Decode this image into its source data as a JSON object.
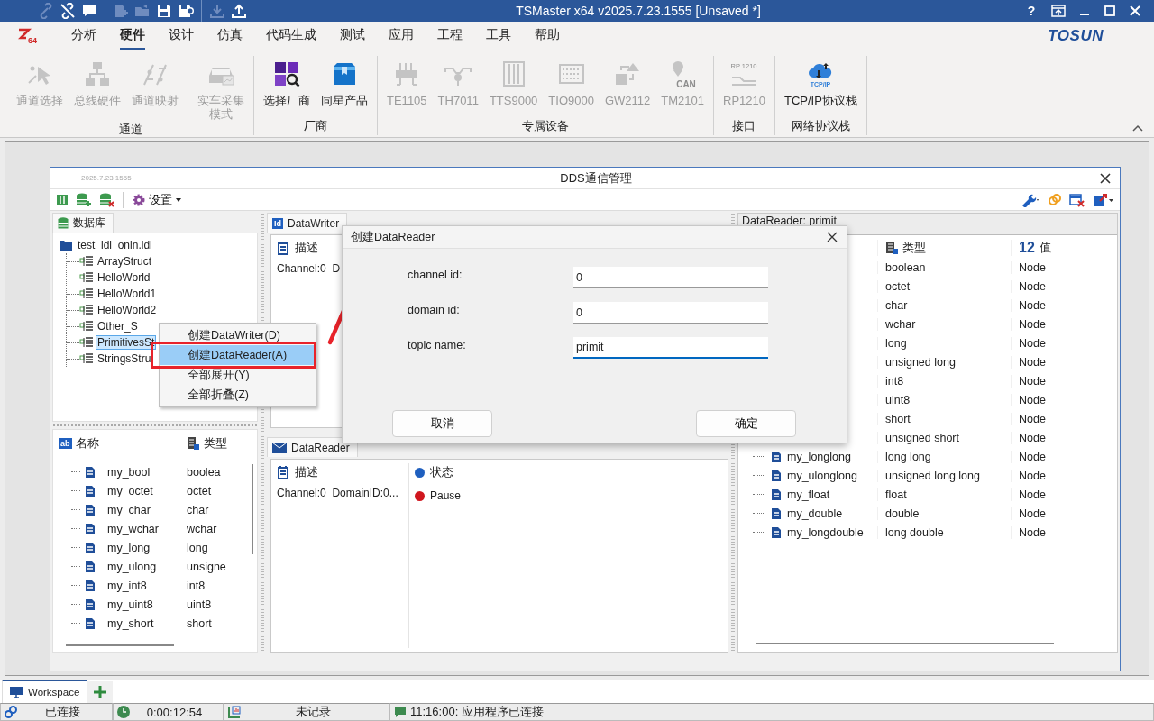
{
  "title_bar": {
    "title": "TSMaster x64 v2025.7.23.1555 [Unsaved *]",
    "help": "?",
    "quick_access": [
      {
        "buttons": [
          {
            "disabled": true
          },
          {
            "disabled": false
          },
          {
            "disabled": false
          }
        ]
      },
      {
        "buttons": [
          {
            "disabled": true
          },
          {
            "disabled": true
          },
          {
            "disabled": false
          },
          {
            "disabled": false
          }
        ]
      },
      {
        "buttons": [
          {
            "disabled": true
          },
          {
            "disabled": false
          }
        ]
      }
    ]
  },
  "menu": {
    "logo_text": "64",
    "brand": "TOSUN",
    "tabs": [
      {
        "label": "分析",
        "selected": false
      },
      {
        "label": "硬件",
        "selected": true
      },
      {
        "label": "设计",
        "selected": false
      },
      {
        "label": "仿真",
        "selected": false
      },
      {
        "label": "代码生成",
        "selected": false
      },
      {
        "label": "测试",
        "selected": false
      },
      {
        "label": "应用",
        "selected": false
      },
      {
        "label": "工程",
        "selected": false
      },
      {
        "label": "工具",
        "selected": false
      },
      {
        "label": "帮助",
        "selected": false
      }
    ]
  },
  "ribbon": {
    "groups": [
      {
        "label": "通道",
        "buttons": [
          {
            "label": "通道选择",
            "disabled": true
          },
          {
            "label": "总线硬件",
            "disabled": true
          },
          {
            "label": "通道映射",
            "disabled": true
          },
          {
            "label": "实车采集模式",
            "disabled": true,
            "divider_before": true,
            "wrapped": true
          }
        ]
      },
      {
        "label": "厂商",
        "buttons": [
          {
            "label": "选择厂商",
            "disabled": false
          },
          {
            "label": "同星产品",
            "disabled": false
          }
        ]
      },
      {
        "label": "专属设备",
        "buttons": [
          {
            "label": "TE1105",
            "disabled": true
          },
          {
            "label": "TH7011",
            "disabled": true
          },
          {
            "label": "TTS9000",
            "disabled": true
          },
          {
            "label": "TIO9000",
            "disabled": true
          },
          {
            "label": "GW2112",
            "disabled": true
          },
          {
            "label": "TM2101",
            "disabled": true,
            "icon_text": "CAN"
          }
        ]
      },
      {
        "label": "接口",
        "buttons": [
          {
            "label": "RP1210",
            "disabled": true,
            "icon_text": "RP 1210"
          }
        ]
      },
      {
        "label": "网络协议栈",
        "buttons": [
          {
            "label": "TCP/IP协议栈",
            "disabled": false,
            "icon_text": "TCP/IP"
          }
        ]
      }
    ]
  },
  "dds_window": {
    "version": "2025.7.23.1555",
    "title": "DDS通信管理",
    "settings": "设置",
    "database": {
      "tab": "数据库",
      "tree": {
        "label": "test_idl_onln.idl",
        "children": [
          {
            "label": "ArrayStruct",
            "selected": false
          },
          {
            "label": "HelloWorld",
            "selected": false
          },
          {
            "label": "HelloWorld1",
            "selected": false
          },
          {
            "label": "HelloWorld2",
            "selected": false
          },
          {
            "label": "Other_S",
            "selected": false
          },
          {
            "label": "PrimitivesSt",
            "selected": true
          },
          {
            "label": "StringsStru",
            "selected": false
          }
        ]
      }
    },
    "fields": {
      "columns": [
        {
          "label": "名称",
          "icon_text": "ab"
        },
        {
          "label": "类型"
        }
      ],
      "rows": [
        {
          "name": "my_bool",
          "type": "boolea"
        },
        {
          "name": "my_octet",
          "type": "octet"
        },
        {
          "name": "my_char",
          "type": "char"
        },
        {
          "name": "my_wchar",
          "type": "wchar"
        },
        {
          "name": "my_long",
          "type": "long"
        },
        {
          "name": "my_ulong",
          "type": "unsigne"
        },
        {
          "name": "my_int8",
          "type": "int8"
        },
        {
          "name": "my_uint8",
          "type": "uint8"
        },
        {
          "name": "my_short",
          "type": "short"
        }
      ]
    },
    "writer": {
      "tab": "DataWriter",
      "tab_icon_text": "Id",
      "columns": [
        "描述"
      ],
      "rows": [
        {
          "description": "Channel:0  D"
        }
      ]
    },
    "reader": {
      "tab": "DataReader",
      "columns": [
        "描述",
        "状态"
      ],
      "rows": [
        {
          "description": "Channel:0  DomainID:0...",
          "status": "Pause",
          "color": "#d0161e"
        }
      ]
    },
    "reader_view": {
      "header": "DataReader: primit",
      "columns": [
        {
          "label": "类型"
        },
        {
          "label": "值",
          "icon_text": "12"
        }
      ],
      "rows": [
        {
          "type": "boolean",
          "value": "Node"
        },
        {
          "type": "octet",
          "value": "Node"
        },
        {
          "type": "char",
          "value": "Node"
        },
        {
          "type": "wchar",
          "value": "Node"
        },
        {
          "type": "long",
          "value": "Node"
        },
        {
          "type": "unsigned long",
          "value": "Node"
        },
        {
          "type": "int8",
          "value": "Node"
        },
        {
          "type": "uint8",
          "value": "Node"
        },
        {
          "type": "short",
          "value": "Node"
        },
        {
          "type": "unsigned short",
          "value": "Node"
        },
        {
          "name": "my_longlong",
          "type": "long long",
          "value": "Node"
        },
        {
          "name": "my_ulonglong",
          "type": "unsigned long long",
          "value": "Node"
        },
        {
          "name": "my_float",
          "type": "float",
          "value": "Node"
        },
        {
          "name": "my_double",
          "type": "double",
          "value": "Node"
        },
        {
          "name": "my_longdouble",
          "type": "long double",
          "value": "Node"
        }
      ]
    }
  },
  "context_menu": {
    "items": [
      {
        "label": "创建DataWriter(D)",
        "selected": false
      },
      {
        "label": "创建DataReader(A)",
        "selected": true
      },
      {
        "label": "全部展开(Y)",
        "selected": false
      },
      {
        "label": "全部折叠(Z)",
        "selected": false
      }
    ]
  },
  "dialog": {
    "title": "创建DataReader",
    "fields": [
      {
        "label": "channel id:",
        "value": "0",
        "focused": false
      },
      {
        "label": "domain id:",
        "value": "0",
        "focused": false
      },
      {
        "label": "topic name:",
        "value": "primit",
        "focused": true
      }
    ],
    "buttons": [
      {
        "label": "取消"
      },
      {
        "label": "确定"
      }
    ]
  },
  "workspace_tabs": [
    {
      "label": "Workspace",
      "selected": true
    }
  ],
  "status_bar": [
    {
      "text": "已连接"
    },
    {
      "text": "0:00:12:54"
    },
    {
      "text": "未记录"
    },
    {
      "text": "11:16:00: 应用程序已连接"
    }
  ]
}
